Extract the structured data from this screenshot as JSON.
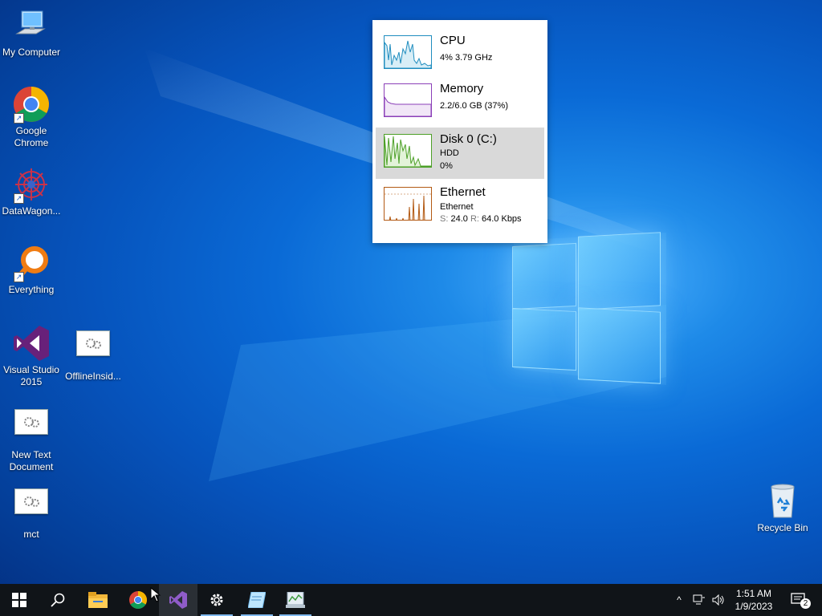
{
  "desktop": {
    "icons": [
      {
        "label": "My Computer"
      },
      {
        "label": "Google\nChrome"
      },
      {
        "label": "DataWagon..."
      },
      {
        "label": "Everything"
      },
      {
        "label": "Visual Studio\n2015"
      },
      {
        "label": "OfflineInsid..."
      },
      {
        "label": "New Text\nDocument"
      },
      {
        "label": "mct"
      },
      {
        "label": "Recycle Bin"
      }
    ]
  },
  "perf_widget": {
    "cpu": {
      "title": "CPU",
      "line1": "4% 3.79 GHz",
      "color": "#1f8dbf"
    },
    "memory": {
      "title": "Memory",
      "line1": "2.2/6.0 GB (37%)",
      "color": "#8b3fb8"
    },
    "disk": {
      "title": "Disk 0 (C:)",
      "line1": "HDD",
      "line2": "0%",
      "color": "#4da028"
    },
    "ethernet": {
      "title": "Ethernet",
      "line1": "Ethernet",
      "send_label": "S:",
      "send_value": "24.0",
      "recv_label": "R:",
      "recv_value": "64.0 Kbps",
      "color": "#b35a14"
    }
  },
  "taskbar": {
    "apps": [
      "start-icon",
      "search-icon",
      "file-explorer-icon",
      "chrome-icon",
      "visual-studio-icon",
      "settings-icon",
      "notepad-icon",
      "task-manager-icon"
    ],
    "tray": {
      "time": "1:51 AM",
      "date": "1/9/2023",
      "notification_count": "2"
    }
  },
  "colors": {
    "taskbar_bg": "#101418",
    "accent": "#7fb9ef"
  }
}
